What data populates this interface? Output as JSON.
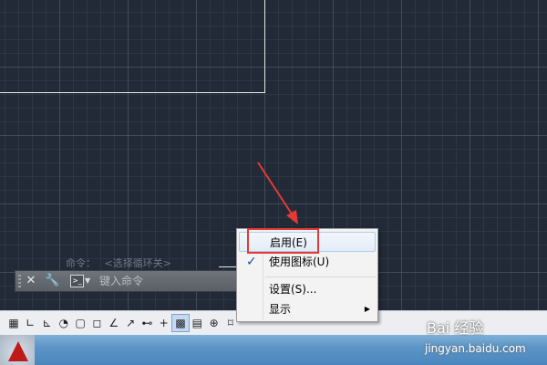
{
  "command_line": {
    "history_label": "命令：",
    "history_value": "<选择循环关>",
    "input_placeholder": "键入命令"
  },
  "context_menu": {
    "items": [
      {
        "label": "启用(E)",
        "checked": false,
        "highlighted": true
      },
      {
        "label": "使用图标(U)",
        "checked": true,
        "highlighted": false
      },
      {
        "label": "设置(S)...",
        "checked": false,
        "highlighted": false
      },
      {
        "label": "显示",
        "checked": false,
        "has_submenu": true
      }
    ],
    "check_glyph": "✓",
    "submenu_glyph": "▶"
  },
  "status_bar": {
    "buttons": [
      {
        "icon": "grid-icon",
        "glyph": "▦",
        "active": false
      },
      {
        "icon": "snap-icon",
        "glyph": "∟",
        "active": false
      },
      {
        "icon": "ortho-icon",
        "glyph": "⊾",
        "active": false
      },
      {
        "icon": "polar-icon",
        "glyph": "◔",
        "active": false
      },
      {
        "icon": "osnap-icon",
        "glyph": "▢",
        "active": false
      },
      {
        "icon": "3dosnap-icon",
        "glyph": "◻",
        "active": false
      },
      {
        "icon": "otrack-icon",
        "glyph": "∠",
        "active": false
      },
      {
        "icon": "ducs-icon",
        "glyph": "↗",
        "active": false
      },
      {
        "icon": "dyn-icon",
        "glyph": "⊷",
        "active": false
      },
      {
        "icon": "lwt-icon",
        "glyph": "+",
        "active": false
      },
      {
        "icon": "transparency-icon",
        "glyph": "▩",
        "active": true
      },
      {
        "icon": "qp-icon",
        "glyph": "▤",
        "active": false
      },
      {
        "icon": "sc-icon",
        "glyph": "⊕",
        "active": false
      },
      {
        "icon": "am-icon",
        "glyph": "⌑",
        "active": false
      }
    ]
  },
  "watermark": {
    "text": "Bai 经验",
    "url": "jingyan.baidu.com"
  },
  "colors": {
    "canvas": "#212a36",
    "annotation": "#e53935",
    "menu_highlight": "#e3ecf7"
  }
}
